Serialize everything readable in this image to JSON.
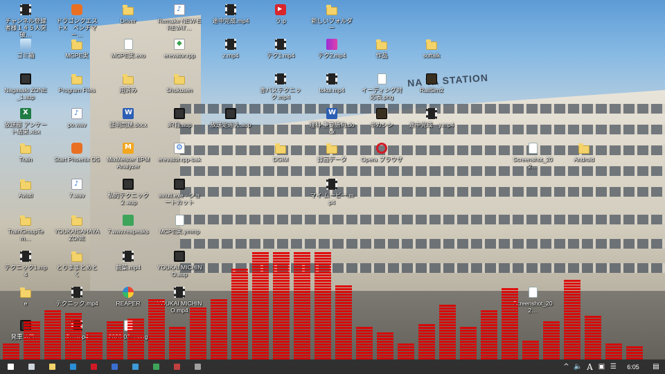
{
  "desktop": {
    "station_sign": "NA    TA STATION",
    "icons": [
      {
        "label": "チャンネル登録者様１４５人突破…",
        "icon": "video-icon"
      },
      {
        "label": "ドラゴンクエストX　ベンチマー…",
        "icon": "game-app-icon"
      },
      {
        "label": "Driver",
        "icon": "folder-icon"
      },
      {
        "label": "Remake NEW-EREVAT…",
        "icon": "audio-file-icon"
      },
      {
        "label": "途中完成.mp4",
        "icon": "video-file-icon"
      },
      {
        "label": "う.p",
        "icon": "youtube-icon"
      },
      {
        "label": "新しいフォルダー",
        "icon": "folder-icon"
      },
      {
        "label": "ゴミ箱",
        "icon": "recycle-bin-icon"
      },
      {
        "label": "MGPE実",
        "icon": "folder-icon"
      },
      {
        "label": "MGPE実.exo",
        "icon": "document-icon"
      },
      {
        "label": "erevator.rpp",
        "icon": "reaper-project-icon"
      },
      {
        "label": "z.mp4",
        "icon": "video-file-icon"
      },
      {
        "label": "テク1.mp4",
        "icon": "video-file-icon"
      },
      {
        "label": "テク2.mp4",
        "icon": "video-file-icon"
      },
      {
        "label": "作品",
        "icon": "folder-icon"
      },
      {
        "label": "softalk",
        "icon": "folder-icon"
      },
      {
        "label": "Nagasaki ZONE_1.aup",
        "icon": "film-icon"
      },
      {
        "label": "Program Files",
        "icon": "folder-icon"
      },
      {
        "label": "用済み",
        "icon": "folder-icon"
      },
      {
        "label": "Shukusen",
        "icon": "folder-icon"
      },
      {
        "label": "赤バステクニック.mp4",
        "icon": "video-file-icon"
      },
      {
        "label": "tokui.mp4",
        "icon": "video-file-icon"
      },
      {
        "label": "イーディング対応表.png",
        "icon": "image-file-icon"
      },
      {
        "label": "RailSim2",
        "icon": "app-icon"
      },
      {
        "label": "放送部 アンケート結果.xlsx",
        "icon": "excel-icon"
      },
      {
        "label": "po.wav",
        "icon": "audio-file-icon"
      },
      {
        "label": "証明問題.docx",
        "icon": "word-icon"
      },
      {
        "label": "JR自.aup",
        "icon": "film-icon"
      },
      {
        "label": "放送定迎え.aup",
        "icon": "film-icon"
      },
      {
        "label": "理科 重要語句.docx",
        "icon": "word-icon"
      },
      {
        "label": "ボカシン",
        "icon": "app-icon"
      },
      {
        "label": "途中完成　y.mp4",
        "icon": "video-file-icon"
      },
      {
        "label": "Train",
        "icon": "folder-icon"
      },
      {
        "label": "Start Phoenix OS",
        "icon": "phoenix-icon"
      },
      {
        "label": "MixMeister BPM Analyzer",
        "icon": "mixmeister-icon"
      },
      {
        "label": "erevator.rpp-bak",
        "icon": "reaper-backup-icon"
      },
      {
        "label": "DGIM",
        "icon": "folder-icon"
      },
      {
        "label": "録画データ",
        "icon": "folder-icon"
      },
      {
        "label": "Opera ブラウザ",
        "icon": "opera-icon"
      },
      {
        "label": "Screenshot_202…",
        "icon": "image-file-icon"
      },
      {
        "label": "Android",
        "icon": "folder-icon"
      },
      {
        "label": "Aviutl",
        "icon": "folder-icon"
      },
      {
        "label": "7.wav",
        "icon": "audio-file-icon"
      },
      {
        "label": "私的テクニック２.aup",
        "icon": "film-icon"
      },
      {
        "label": "aviutl.exe - ショートカット",
        "icon": "film-icon"
      },
      {
        "label": "マイ ムービー.mp4",
        "icon": "video-file-icon"
      },
      {
        "label": "TrainGroupTem…",
        "icon": "folder-icon"
      },
      {
        "label": "YOUKAISAHAYA ZONE",
        "icon": "folder-icon"
      },
      {
        "label": "7.wav.reapeaks",
        "icon": "reapeaks-file-icon"
      },
      {
        "label": "MCPE実.ymmp",
        "icon": "document-icon"
      },
      {
        "label": "テクニック1.mp4",
        "icon": "video-file-icon"
      },
      {
        "label": "とりままとめとく",
        "icon": "folder-icon"
      },
      {
        "label": "前菜.mp4",
        "icon": "video-file-icon"
      },
      {
        "label": "YOUKAI MICHINO.aup",
        "icon": "film-icon"
      },
      {
        "label": "e",
        "icon": "folder-icon"
      },
      {
        "label": "テクニック.mp4",
        "icon": "video-file-icon"
      },
      {
        "label": "REAPER",
        "icon": "reaper-icon"
      },
      {
        "label": "YOUKAI MICHINO.mp4",
        "icon": "video-file-icon"
      },
      {
        "label": "Screenshot_202…",
        "icon": "image-file-icon"
      },
      {
        "label": "発車メロ…",
        "icon": "film-icon"
      },
      {
        "label": "あ…mp4",
        "icon": "video-file-icon"
      },
      {
        "label": "2020-02-…png",
        "icon": "image-file-icon"
      }
    ]
  },
  "visualizer": {
    "color": "#e00000",
    "levels": [
      0.14,
      0.33,
      0.43,
      0.41,
      0.24,
      0.35,
      0.37,
      0.54,
      0.28,
      0.46,
      0.55,
      0.81,
      0.96,
      0.96,
      0.96,
      0.96,
      0.67,
      0.3,
      0.24,
      0.14,
      0.31,
      0.49,
      0.3,
      0.45,
      0.65,
      0.17,
      0.35,
      0.72,
      0.4,
      0.15,
      0.11
    ]
  },
  "taskbar": {
    "buttons": [
      {
        "name": "start-button",
        "color": "#ffffff"
      },
      {
        "name": "task-view-button",
        "color": "#cfd6de"
      },
      {
        "name": "taskbar-app-explorer",
        "color": "#f3d36a"
      },
      {
        "name": "taskbar-app-edge",
        "color": "#2a8fd8"
      },
      {
        "name": "taskbar-app-opera",
        "color": "#d21a25"
      },
      {
        "name": "taskbar-app-store",
        "color": "#3a6fd0"
      },
      {
        "name": "taskbar-app-mail",
        "color": "#3d9bd9"
      },
      {
        "name": "taskbar-app-chrome",
        "color": "#3da45a"
      },
      {
        "name": "taskbar-app-aviutl",
        "color": "#c04040"
      },
      {
        "name": "taskbar-app-reaper",
        "color": "#a0a0a0"
      }
    ],
    "tray": {
      "chevron": "^",
      "ime": "A",
      "clock": "6:05"
    }
  }
}
